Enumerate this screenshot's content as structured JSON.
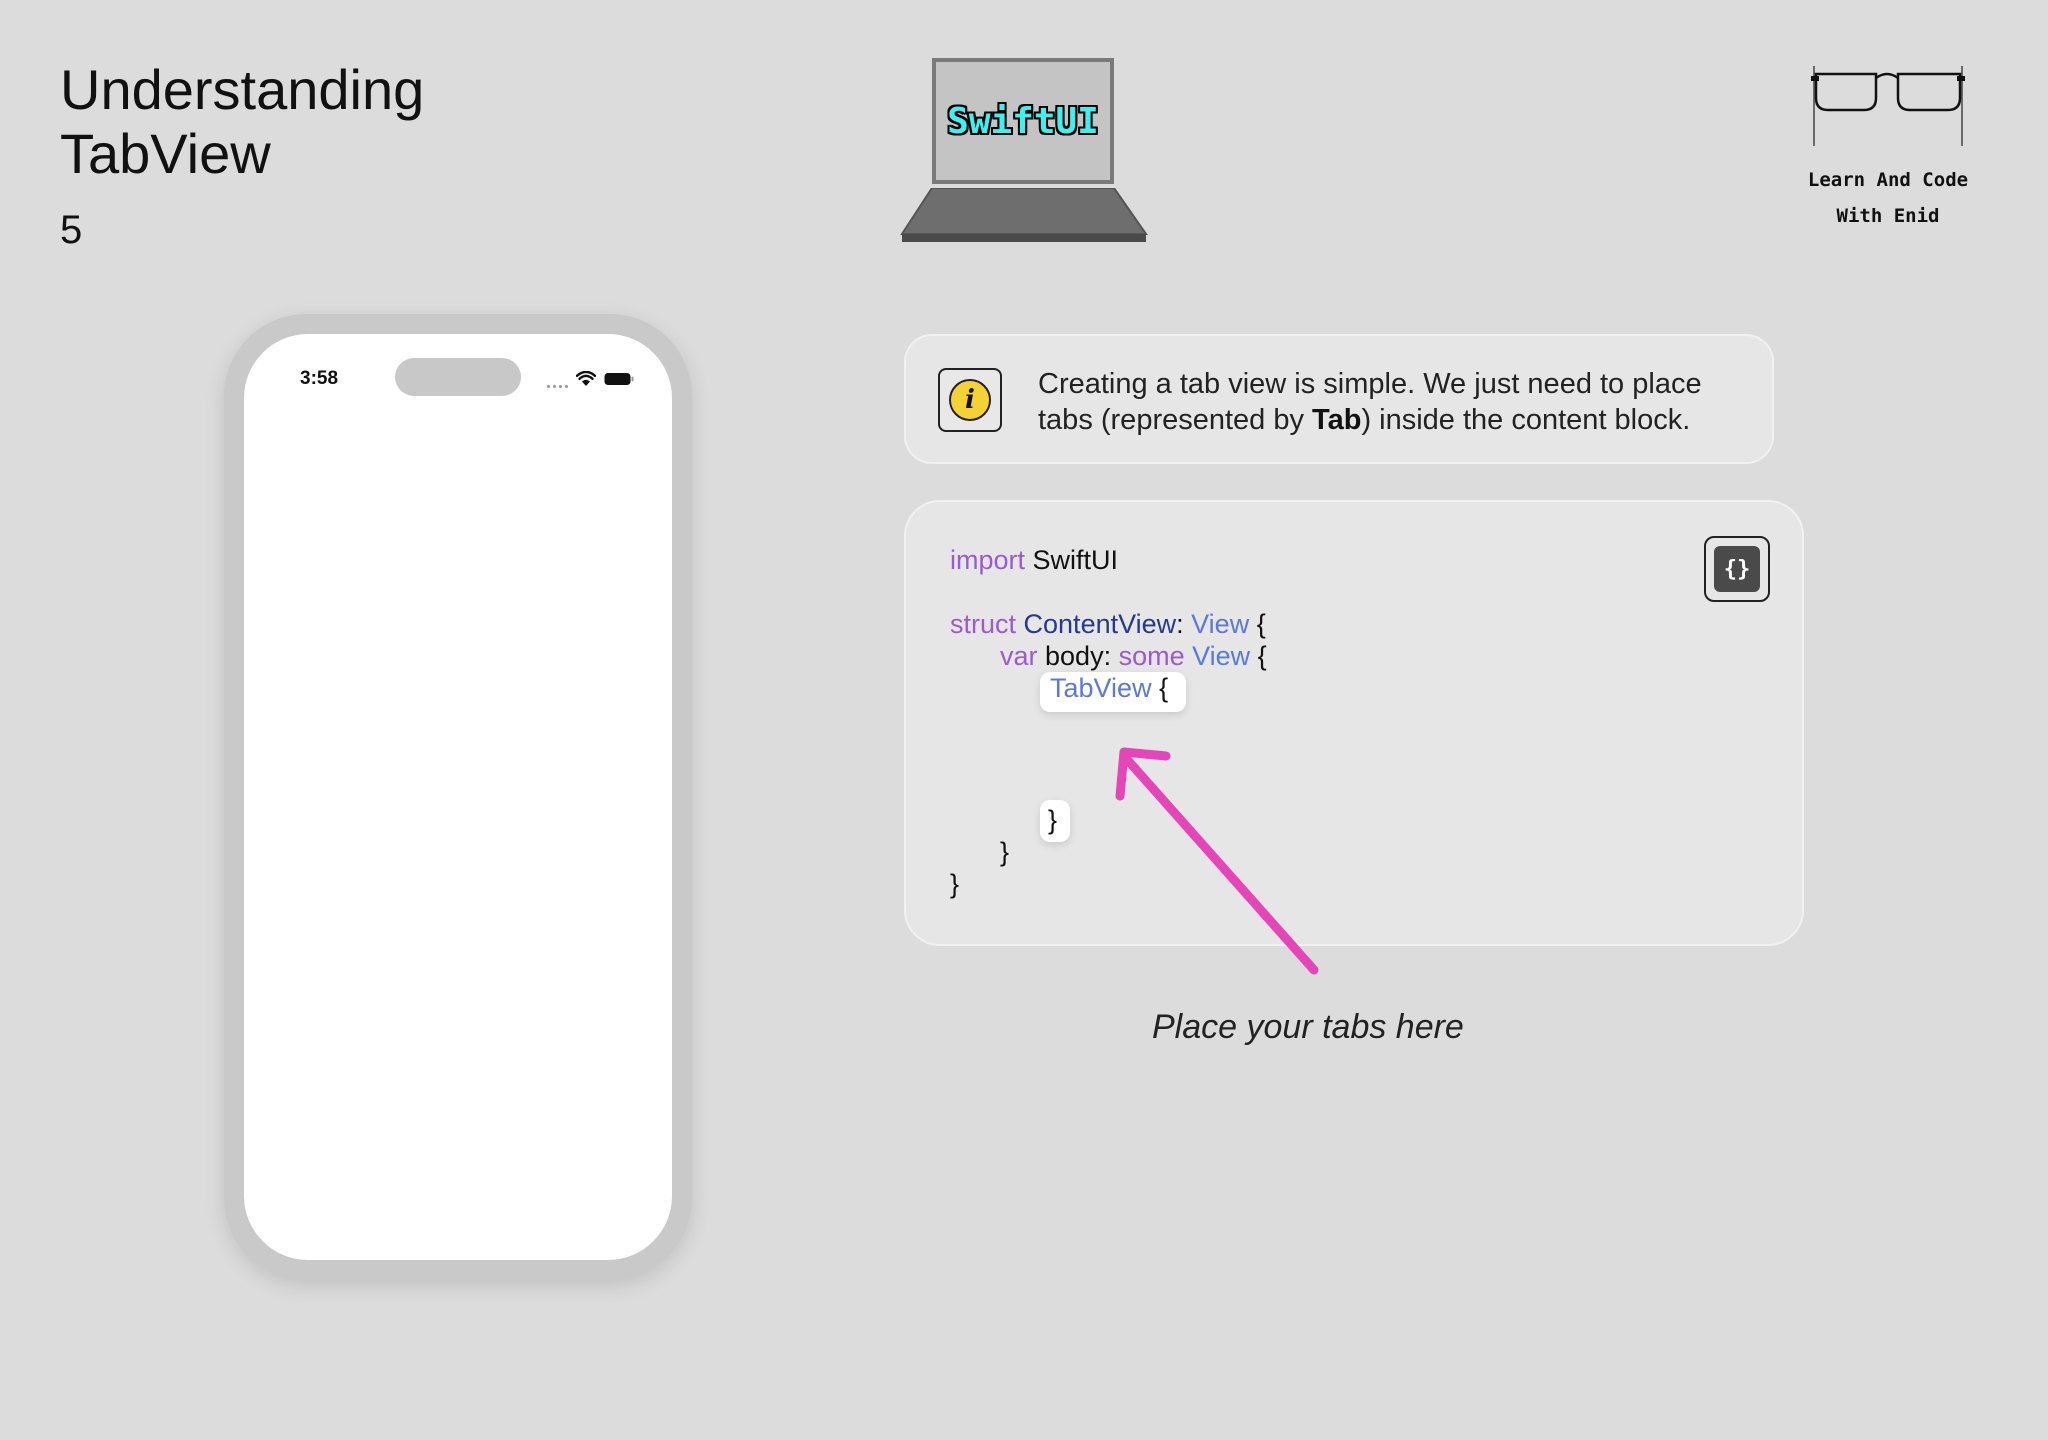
{
  "header": {
    "title_line1": "Understanding",
    "title_line2": "TabView",
    "page_number": "5"
  },
  "logo": {
    "text": "SwiftUI",
    "icon": "laptop-icon",
    "text_color": "#3df2ee"
  },
  "brand": {
    "icon": "glasses-icon",
    "text": "Learn And Code\nWith Enid"
  },
  "phone": {
    "time": "3:58",
    "icons": [
      "wifi-icon",
      "battery-icon"
    ]
  },
  "info": {
    "icon": "info-icon",
    "text_before": "Creating a tab view is simple. We just need to place tabs (represented by ",
    "text_bold": "Tab",
    "text_after": ") inside the content block.",
    "accent_color": "#f4d233"
  },
  "code": {
    "button_icon": "braces-icon",
    "button_label": "{}",
    "line1_kw": "import",
    "line1_name": " SwiftUI",
    "line2_kw": "struct",
    "line2_name": "ContentView",
    "line2_colon": ": ",
    "line2_type": "View",
    "line2_brace": " {",
    "line3_kw": "var",
    "line3_name": " body: ",
    "line3_kw2": "some",
    "line3_type": " View",
    "line3_brace": " {",
    "line4_type": "TabView",
    "line4_brace": " {",
    "close_inner": "}",
    "close_body": "}",
    "close_struct": "}"
  },
  "annotation": {
    "caption": "Place your tabs here",
    "arrow_color": "#e645b8"
  }
}
